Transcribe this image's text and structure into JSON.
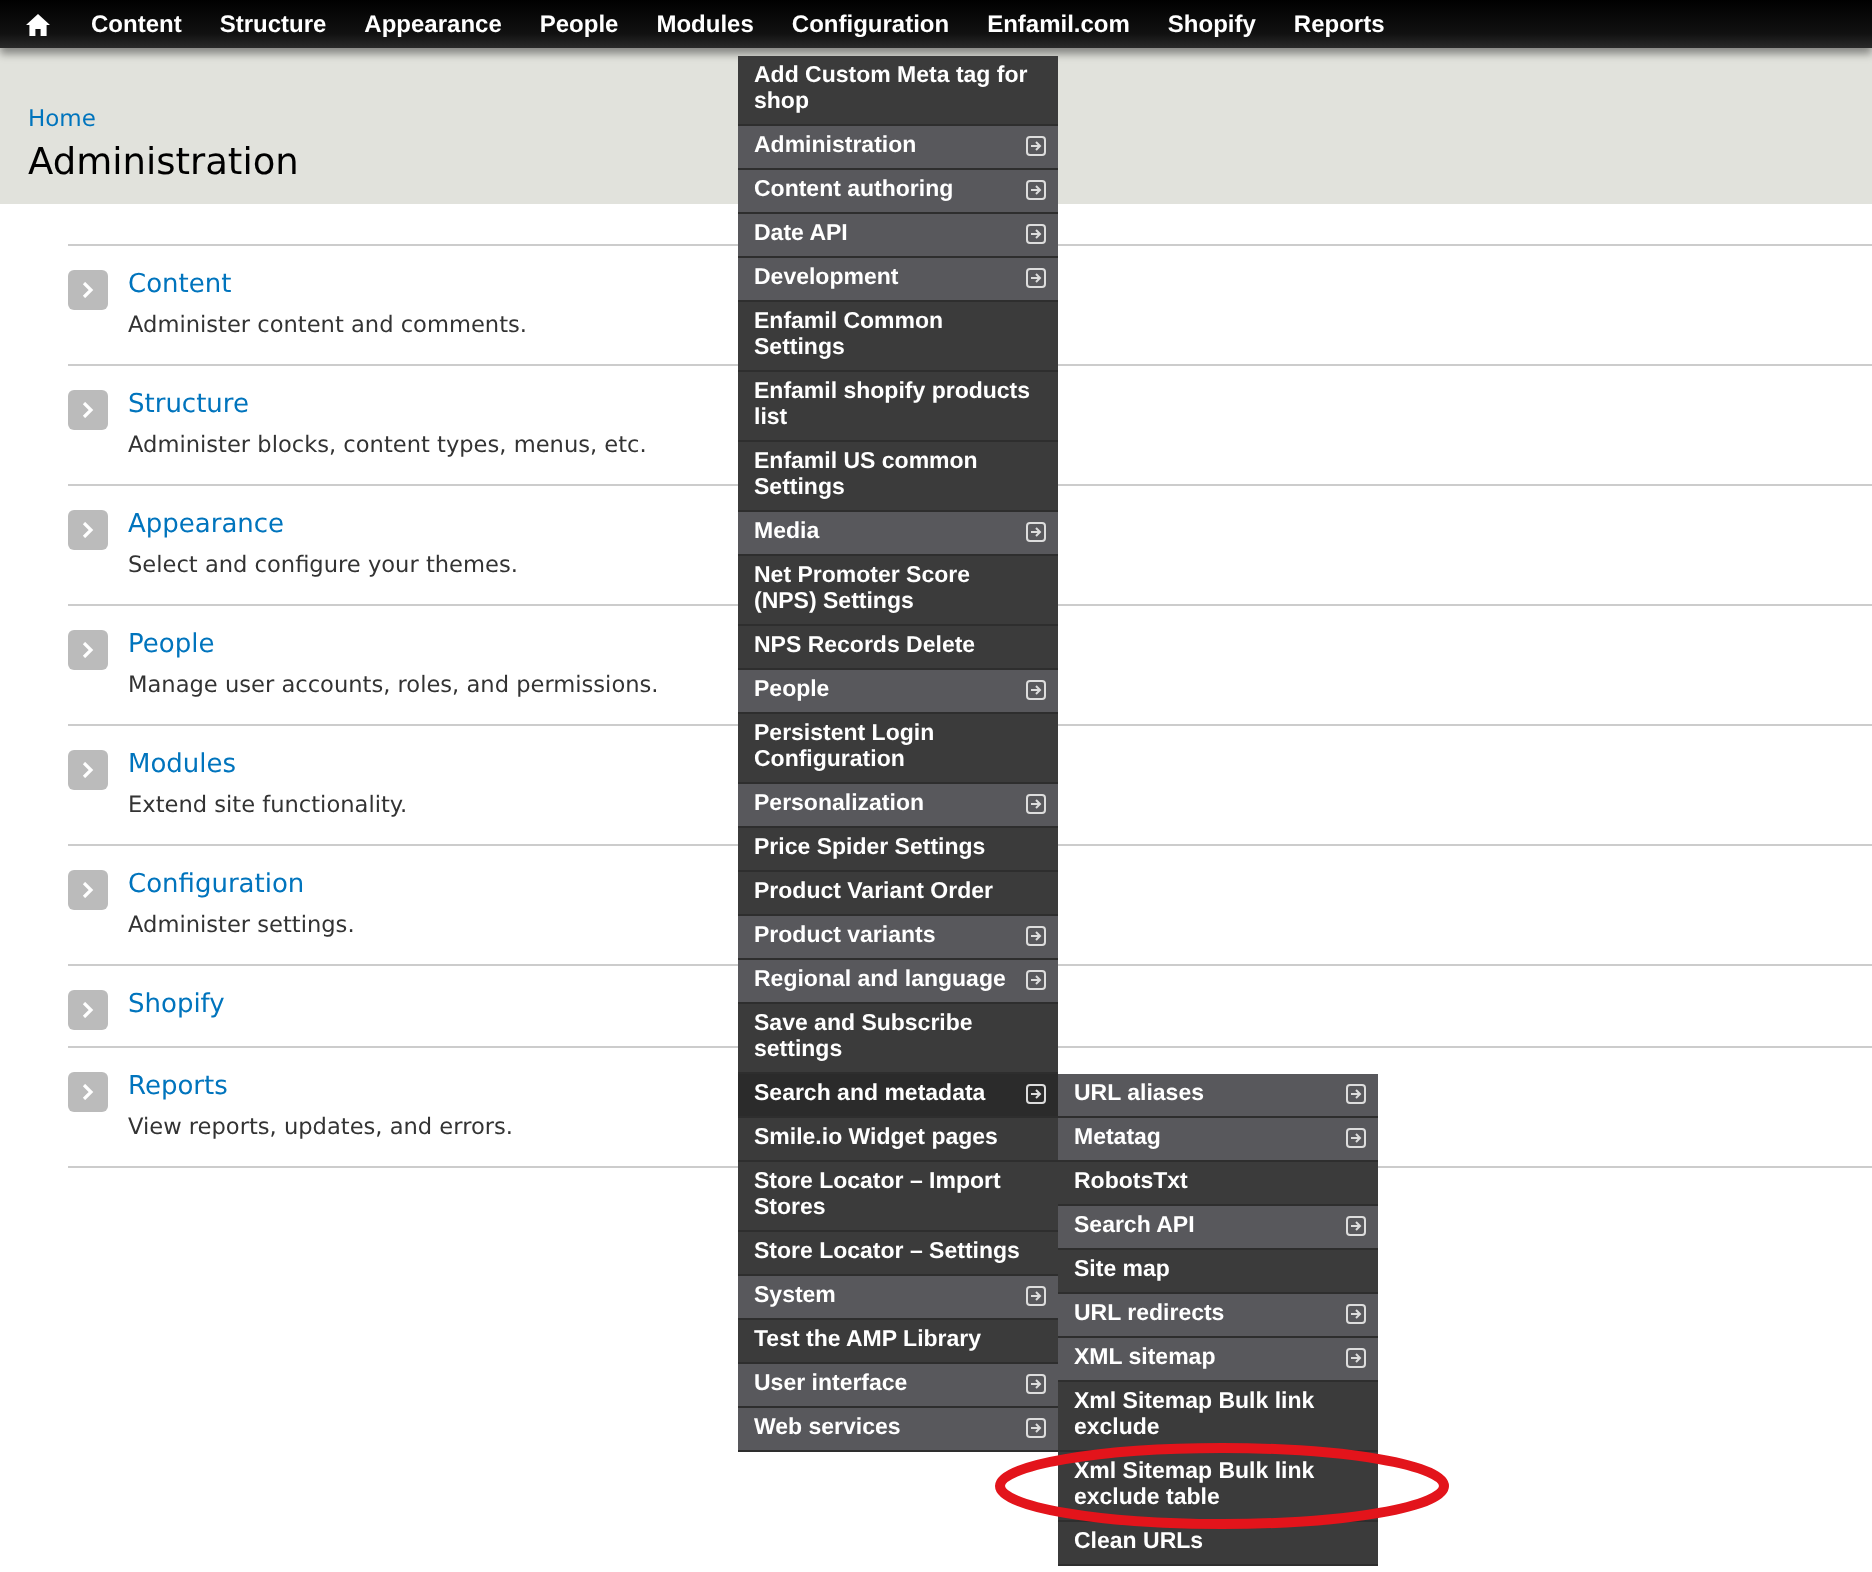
{
  "toolbar": {
    "items": [
      {
        "label": "Content"
      },
      {
        "label": "Structure"
      },
      {
        "label": "Appearance"
      },
      {
        "label": "People"
      },
      {
        "label": "Modules"
      },
      {
        "label": "Configuration"
      },
      {
        "label": "Enfamil.com"
      },
      {
        "label": "Shopify"
      },
      {
        "label": "Reports"
      }
    ]
  },
  "breadcrumb": [
    "Home"
  ],
  "page_title": "Administration",
  "sections": [
    {
      "title": "Content",
      "description": "Administer content and comments."
    },
    {
      "title": "Structure",
      "description": "Administer blocks, content types, menus, etc."
    },
    {
      "title": "Appearance",
      "description": "Select and configure your themes."
    },
    {
      "title": "People",
      "description": "Manage user accounts, roles, and permissions."
    },
    {
      "title": "Modules",
      "description": "Extend site functionality."
    },
    {
      "title": "Configuration",
      "description": "Administer settings."
    },
    {
      "title": "Shopify"
    },
    {
      "title": "Reports",
      "description": "View reports, updates, and errors."
    }
  ],
  "dropdown": {
    "items": [
      {
        "label": "Add Custom Meta tag for shop",
        "has_children": false,
        "selected": false
      },
      {
        "label": "Administration",
        "has_children": true,
        "selected": false
      },
      {
        "label": "Content authoring",
        "has_children": true,
        "selected": false
      },
      {
        "label": "Date API",
        "has_children": true,
        "selected": false
      },
      {
        "label": "Development",
        "has_children": true,
        "selected": false
      },
      {
        "label": "Enfamil Common Settings",
        "has_children": false,
        "selected": false
      },
      {
        "label": "Enfamil shopify products list",
        "has_children": false,
        "selected": false
      },
      {
        "label": "Enfamil US common Settings",
        "has_children": false,
        "selected": false
      },
      {
        "label": "Media",
        "has_children": true,
        "selected": false
      },
      {
        "label": "Net Promoter Score (NPS) Settings",
        "has_children": false,
        "selected": false
      },
      {
        "label": "NPS Records Delete",
        "has_children": false,
        "selected": false
      },
      {
        "label": "People",
        "has_children": true,
        "selected": false
      },
      {
        "label": "Persistent Login Configuration",
        "has_children": false,
        "selected": false
      },
      {
        "label": "Personalization",
        "has_children": true,
        "selected": false
      },
      {
        "label": "Price Spider Settings",
        "has_children": false,
        "selected": false
      },
      {
        "label": "Product Variant Order",
        "has_children": false,
        "selected": false
      },
      {
        "label": "Product variants",
        "has_children": true,
        "selected": false
      },
      {
        "label": "Regional and language",
        "has_children": true,
        "selected": false
      },
      {
        "label": "Save and Subscribe settings",
        "has_children": false,
        "selected": false
      },
      {
        "label": "Search and metadata",
        "has_children": true,
        "selected": true,
        "children": [
          {
            "label": "URL aliases",
            "has_children": true,
            "circled": false
          },
          {
            "label": "Metatag",
            "has_children": true,
            "circled": false
          },
          {
            "label": "RobotsTxt",
            "has_children": false,
            "circled": false
          },
          {
            "label": "Search API",
            "has_children": true,
            "circled": false
          },
          {
            "label": "Site map",
            "has_children": false,
            "circled": false
          },
          {
            "label": "URL redirects",
            "has_children": true,
            "circled": false
          },
          {
            "label": "XML sitemap",
            "has_children": true,
            "circled": false
          },
          {
            "label": "Xml Sitemap Bulk link exclude",
            "has_children": false,
            "circled": false
          },
          {
            "label": "Xml Sitemap Bulk link exclude table",
            "has_children": false,
            "circled": true
          },
          {
            "label": "Clean URLs",
            "has_children": false,
            "circled": false
          }
        ]
      },
      {
        "label": "Smile.io Widget pages",
        "has_children": false,
        "selected": false
      },
      {
        "label": "Store Locator – Import Stores",
        "has_children": false,
        "selected": false
      },
      {
        "label": "Store Locator – Settings",
        "has_children": false,
        "selected": false
      },
      {
        "label": "System",
        "has_children": true,
        "selected": false
      },
      {
        "label": "Test the AMP Library",
        "has_children": false,
        "selected": false
      },
      {
        "label": "User interface",
        "has_children": true,
        "selected": false
      },
      {
        "label": "Web services",
        "has_children": true,
        "selected": false
      }
    ]
  }
}
